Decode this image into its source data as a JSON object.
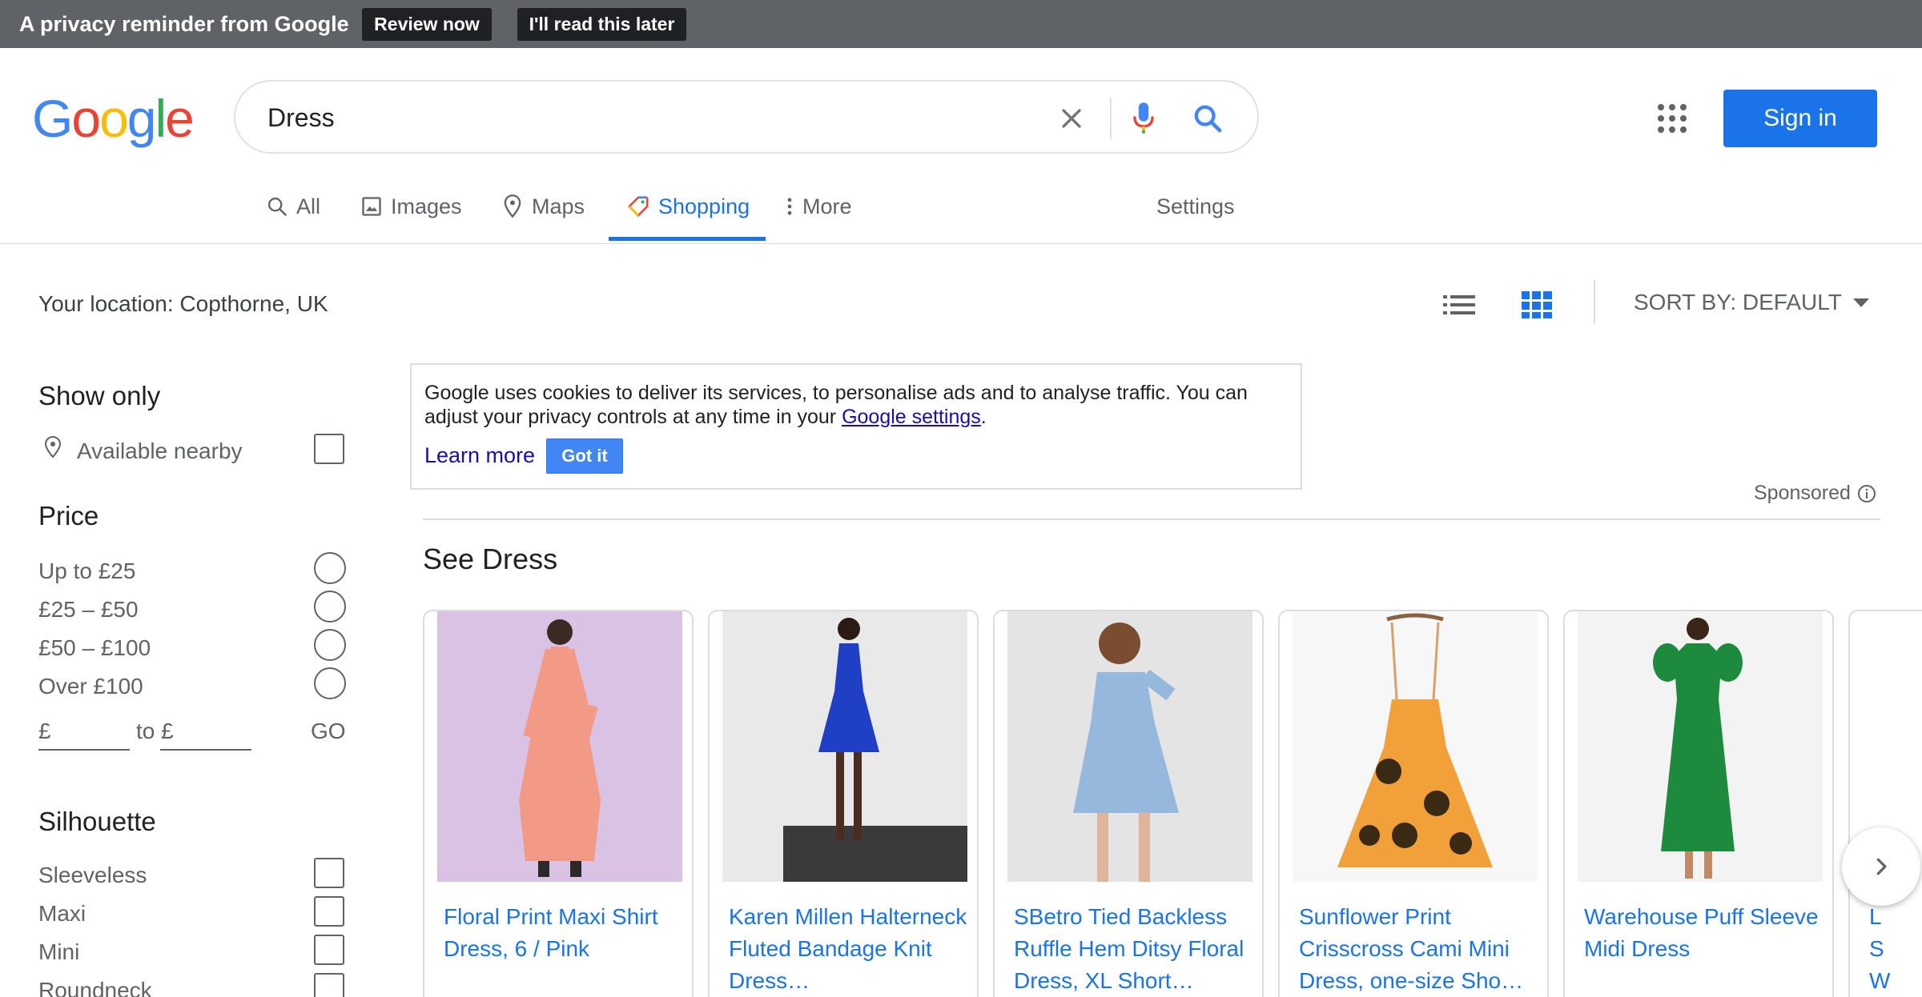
{
  "privacy_bar": {
    "text": "A privacy reminder from Google",
    "review_label": "Review now",
    "later_label": "I'll read this later"
  },
  "logo": {
    "letters": [
      "G",
      "o",
      "o",
      "g",
      "l",
      "e"
    ],
    "colors": [
      "#4285F4",
      "#EA4335",
      "#FBBC05",
      "#4285F4",
      "#34A853",
      "#EA4335"
    ]
  },
  "search": {
    "value": "Dress"
  },
  "header": {
    "sign_in_label": "Sign in"
  },
  "tabs": [
    {
      "label": "All",
      "icon": "search-icon"
    },
    {
      "label": "Images",
      "icon": "image-icon"
    },
    {
      "label": "Maps",
      "icon": "map-pin-icon"
    },
    {
      "label": "Shopping",
      "icon": "tag-icon",
      "active": true
    },
    {
      "label": "More",
      "icon": "more-vert-icon"
    },
    {
      "label": "Settings"
    }
  ],
  "location": "Your location: Copthorne, UK",
  "sort": {
    "label": "SORT BY: DEFAULT"
  },
  "sidebar": {
    "show_only": {
      "heading": "Show only",
      "nearby": "Available nearby"
    },
    "price": {
      "heading": "Price",
      "options": [
        "Up to £25",
        "£25 – £50",
        "£50 – £100",
        "Over £100"
      ],
      "from_prefix": "£",
      "to_prefix": "to £",
      "go_label": "GO"
    },
    "silhouette": {
      "heading": "Silhouette",
      "options": [
        "Sleeveless",
        "Maxi",
        "Mini",
        "Roundneck"
      ]
    }
  },
  "cookie": {
    "text": "Google uses cookies to deliver its services, to personalise ads and to analyse traffic. You can adjust your privacy controls at any time in your",
    "link": "Google settings",
    "period": ".",
    "learn_more": "Learn more",
    "got_it": "Got it"
  },
  "sponsored": "Sponsored",
  "section_title": "See Dress",
  "products": [
    {
      "title": "Floral Print Maxi Shirt Dress, 6 / Pink",
      "bg": "#d9c2e4",
      "dress": "#f29a86"
    },
    {
      "title": "Karen Millen Halterneck Fluted Bandage Knit Dress…",
      "bg": "#e9e9ea",
      "dress": "#1f3fc4"
    },
    {
      "title": "SBetro Tied Backless Ruffle Hem Ditsy Floral Dress, XL Short…",
      "bg": "#e4e4e4",
      "dress": "#97b8dd"
    },
    {
      "title": "Sunflower Print Crisscross Cami Mini Dress, one-size Sho…",
      "bg": "#f7f7f7",
      "dress": "#f2a13a"
    },
    {
      "title": "Warehouse Puff Sleeve Midi Dress",
      "bg": "#f3f3f3",
      "dress": "#1d8a3e"
    }
  ],
  "partial_card_letters": [
    "L",
    "S",
    "W"
  ],
  "colors": {
    "accent": "#1a73e8",
    "privacy_bar": "#5f6368",
    "link": "#1a0dab"
  }
}
